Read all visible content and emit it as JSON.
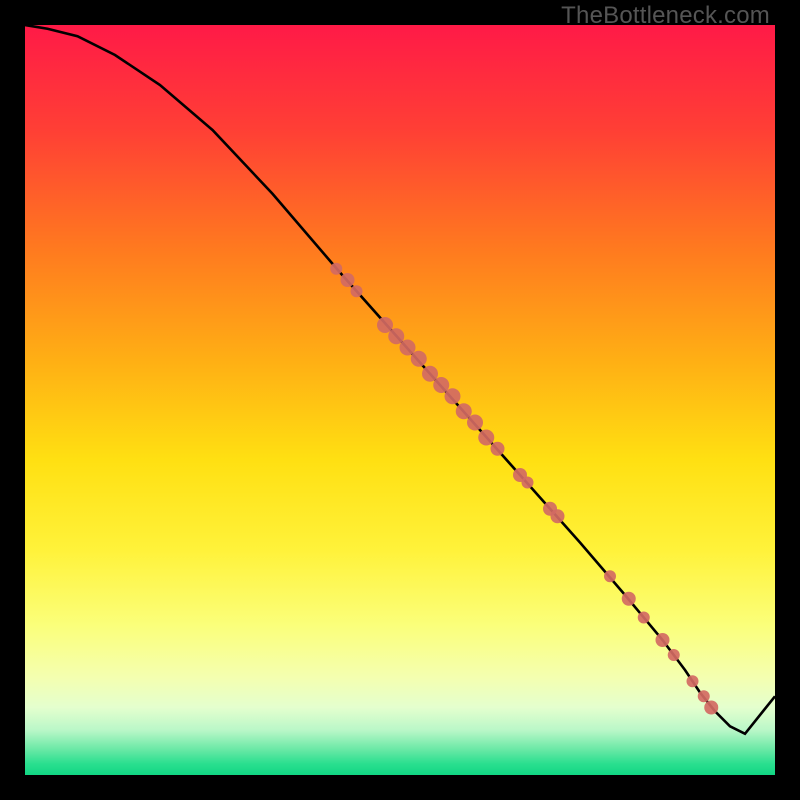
{
  "watermark": "TheBottleneck.com",
  "chart_data": {
    "type": "line",
    "title": "",
    "xlabel": "",
    "ylabel": "",
    "xlim": [
      0,
      100
    ],
    "ylim": [
      0,
      100
    ],
    "gradient_stops": [
      {
        "offset": 0.0,
        "color": "#ff1a47"
      },
      {
        "offset": 0.14,
        "color": "#ff3f35"
      },
      {
        "offset": 0.3,
        "color": "#ff7a1f"
      },
      {
        "offset": 0.45,
        "color": "#ffb014"
      },
      {
        "offset": 0.58,
        "color": "#ffe012"
      },
      {
        "offset": 0.7,
        "color": "#fff23a"
      },
      {
        "offset": 0.8,
        "color": "#fbff7a"
      },
      {
        "offset": 0.87,
        "color": "#f4ffb0"
      },
      {
        "offset": 0.91,
        "color": "#e4ffce"
      },
      {
        "offset": 0.94,
        "color": "#baf7c8"
      },
      {
        "offset": 0.965,
        "color": "#6de9a7"
      },
      {
        "offset": 0.985,
        "color": "#2adf8f"
      },
      {
        "offset": 1.0,
        "color": "#11d684"
      }
    ],
    "series": [
      {
        "name": "curve",
        "x": [
          0,
          3,
          7,
          12,
          18,
          25,
          33,
          42,
          50,
          58,
          66,
          74,
          80,
          85,
          88,
          90,
          92,
          94,
          96,
          100
        ],
        "y": [
          100,
          99.5,
          98.5,
          96,
          92,
          86,
          77.5,
          67,
          58,
          49,
          40,
          31,
          24,
          18,
          14,
          11,
          8.5,
          6.5,
          5.5,
          10.5
        ]
      }
    ],
    "points": {
      "name": "markers",
      "color": "#d26a63",
      "coords": [
        {
          "x": 41.5,
          "y": 67.5,
          "r": 6
        },
        {
          "x": 43.0,
          "y": 66.0,
          "r": 7
        },
        {
          "x": 44.2,
          "y": 64.5,
          "r": 6
        },
        {
          "x": 48.0,
          "y": 60.0,
          "r": 8
        },
        {
          "x": 49.5,
          "y": 58.5,
          "r": 8
        },
        {
          "x": 51.0,
          "y": 57.0,
          "r": 8
        },
        {
          "x": 52.5,
          "y": 55.5,
          "r": 8
        },
        {
          "x": 54.0,
          "y": 53.5,
          "r": 8
        },
        {
          "x": 55.5,
          "y": 52.0,
          "r": 8
        },
        {
          "x": 57.0,
          "y": 50.5,
          "r": 8
        },
        {
          "x": 58.5,
          "y": 48.5,
          "r": 8
        },
        {
          "x": 60.0,
          "y": 47.0,
          "r": 8
        },
        {
          "x": 61.5,
          "y": 45.0,
          "r": 8
        },
        {
          "x": 63.0,
          "y": 43.5,
          "r": 7
        },
        {
          "x": 66.0,
          "y": 40.0,
          "r": 7
        },
        {
          "x": 67.0,
          "y": 39.0,
          "r": 6
        },
        {
          "x": 70.0,
          "y": 35.5,
          "r": 7
        },
        {
          "x": 71.0,
          "y": 34.5,
          "r": 7
        },
        {
          "x": 78.0,
          "y": 26.5,
          "r": 6
        },
        {
          "x": 80.5,
          "y": 23.5,
          "r": 7
        },
        {
          "x": 82.5,
          "y": 21.0,
          "r": 6
        },
        {
          "x": 85.0,
          "y": 18.0,
          "r": 7
        },
        {
          "x": 86.5,
          "y": 16.0,
          "r": 6
        },
        {
          "x": 89.0,
          "y": 12.5,
          "r": 6
        },
        {
          "x": 90.5,
          "y": 10.5,
          "r": 6
        },
        {
          "x": 91.5,
          "y": 9.0,
          "r": 7
        }
      ]
    }
  }
}
